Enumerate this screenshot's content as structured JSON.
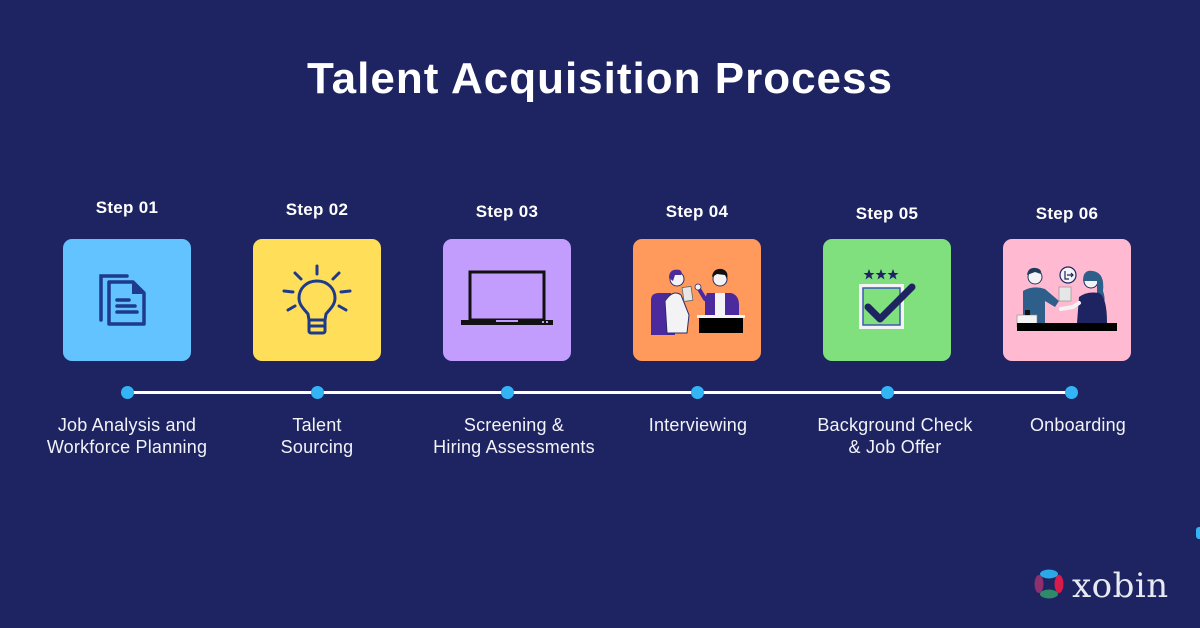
{
  "title": "Talent Acquisition Process",
  "colors": {
    "background": "#1e2461",
    "timeline_dot": "#33b5f5",
    "timeline_line": "#ffffff"
  },
  "steps": [
    {
      "label": "Step 01",
      "title": "Job Analysis and Workforce Planning",
      "title_lines": [
        "Job Analysis and",
        "Workforce Planning"
      ],
      "icon": "documents-icon",
      "card_color": "#62c3fe"
    },
    {
      "label": "Step 02",
      "title": "Talent Sourcing",
      "title_lines": [
        "Talent",
        "Sourcing"
      ],
      "icon": "lightbulb-icon",
      "card_color": "#ffde59"
    },
    {
      "label": "Step 03",
      "title": "Screening & Hiring Assessments",
      "title_lines": [
        "Screening &",
        "Hiring Assessments"
      ],
      "icon": "laptop-icon",
      "card_color": "#c29dfd"
    },
    {
      "label": "Step 04",
      "title": "Interviewing",
      "title_lines": [
        "Interviewing"
      ],
      "icon": "interview-illustration-icon",
      "card_color": "#ff9a5c"
    },
    {
      "label": "Step 05",
      "title": "Background Check & Job Offer",
      "title_lines": [
        "Background Check",
        "& Job Offer"
      ],
      "icon": "checkbox-stars-icon",
      "card_color": "#80e07e"
    },
    {
      "label": "Step 06",
      "title": "Onboarding",
      "title_lines": [
        "Onboarding"
      ],
      "icon": "handshake-illustration-icon",
      "card_color": "#ffbad1"
    }
  ],
  "logo": {
    "text": "xobin",
    "icon": "xobin-logo-icon"
  }
}
